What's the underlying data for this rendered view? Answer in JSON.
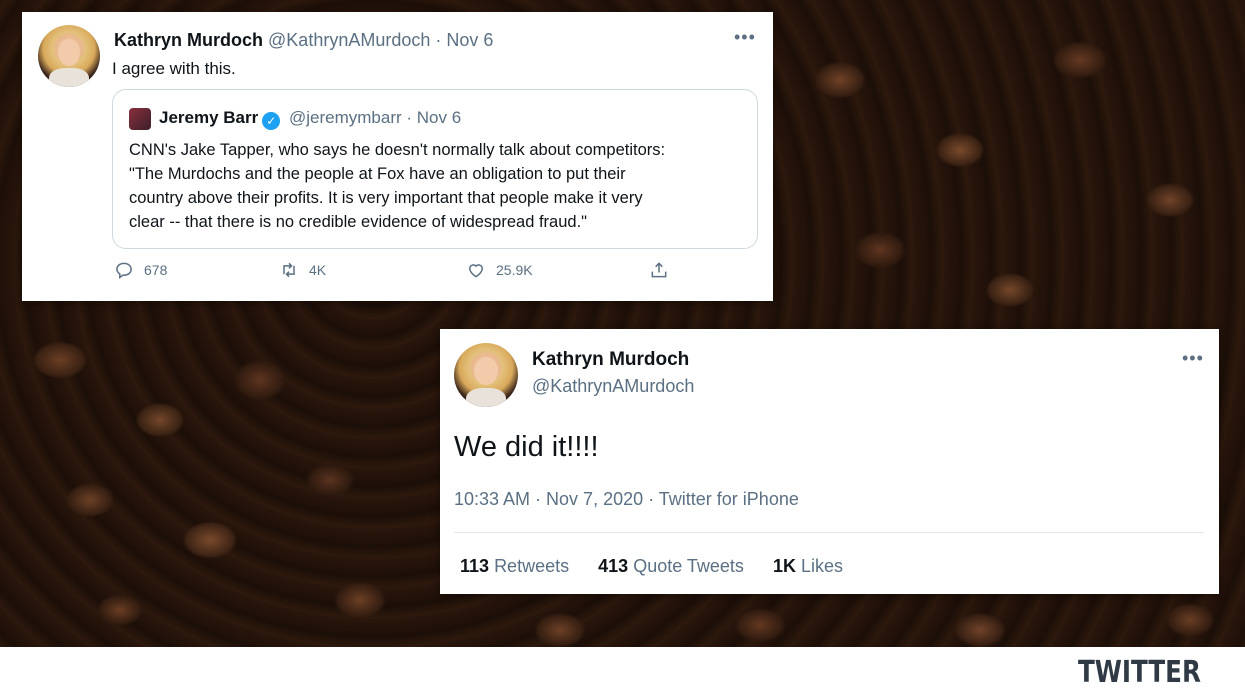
{
  "card1": {
    "author_name": "Kathryn Murdoch",
    "author_handle": "@KathrynAMurdoch",
    "date": "· Nov 6",
    "more": "•••",
    "text": "I agree with this.",
    "quoted": {
      "author_name": "Jeremy Barr",
      "verified_mark": "✓",
      "author_handle": "@jeremymbarr",
      "date": "· Nov 6",
      "text_lines": [
        "CNN's Jake Tapper, who says he doesn't normally talk about competitors:",
        "\"The Murdochs and the people at Fox have an obligation to put their",
        "country above their profits. It is very important that people make it very",
        "clear -- that there is no credible evidence of widespread fraud.\""
      ]
    },
    "actions": {
      "replies": "678",
      "retweets": "4K",
      "likes": "25.9K"
    }
  },
  "card2": {
    "author_name": "Kathryn Murdoch",
    "author_handle": "@KathrynAMurdoch",
    "more": "•••",
    "text": "We did it!!!!",
    "meta": "10:33 AM · Nov 7, 2020 · Twitter for iPhone",
    "stats": {
      "retweets_count": "113",
      "retweets_label": "Retweets",
      "quotes_count": "413",
      "quotes_label": "Quote Tweets",
      "likes_count": "1K",
      "likes_label": "Likes"
    }
  },
  "footer": {
    "brand": "TWITTER"
  },
  "icons": {
    "reply": "reply-icon",
    "retweet": "retweet-icon",
    "like": "heart-icon",
    "share": "share-icon",
    "verified": "verified-badge-icon"
  },
  "colors": {
    "accent": "#1da1f2",
    "muted_text": "#5b7083",
    "primary_text": "#0f1419",
    "footer_brand": "#2f3a44"
  }
}
